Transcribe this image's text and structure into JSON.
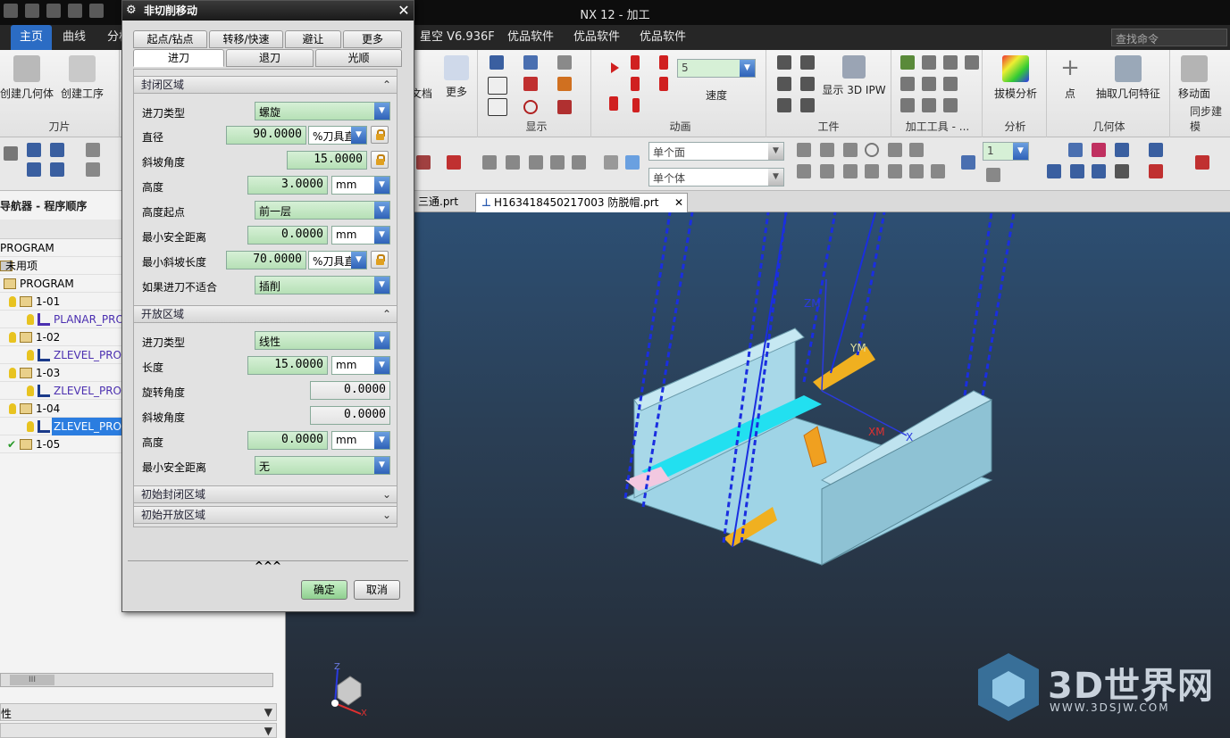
{
  "app": {
    "title": "NX 12 - 加工",
    "search_placeholder": "查找命令"
  },
  "menu": {
    "tabs": [
      "主页",
      "曲线",
      "分析",
      "星空 V6.936F",
      "优品软件",
      "优品软件",
      "优品软件"
    ]
  },
  "ribbon": {
    "left_buttons": [
      "创建几何体",
      "创建工序"
    ],
    "left_group": "刀片",
    "more_btns": [
      "文档",
      "更多"
    ],
    "display_group": "显示",
    "anim_group": "动画",
    "speed_value": "5",
    "speed_label": "速度",
    "show_ipw": "显示 3D IPW",
    "workpiece_group": "工件",
    "machining_tools_group": "加工工具 - ...",
    "draft_analysis": "拔模分析",
    "analysis_group": "分析",
    "point": "点",
    "extract_geom": "抽取几何特征",
    "geometry_group": "几何体",
    "move_face": "移动面",
    "sync_modeling": "同步建模"
  },
  "toolbar2": {
    "filter_face": "单个面",
    "filter_body": "单个体",
    "layer_value": "1"
  },
  "navigator": {
    "title": "导航器 - 程序顺序",
    "rows": [
      {
        "text": "PROGRAM",
        "type": "root"
      },
      {
        "text": "未用项",
        "type": "folder"
      },
      {
        "text": "PROGRAM",
        "type": "folder"
      },
      {
        "text": "1-01",
        "type": "group"
      },
      {
        "text": "PLANAR_PROFILE",
        "type": "op"
      },
      {
        "text": "1-02",
        "type": "group"
      },
      {
        "text": "ZLEVEL_PROFILE",
        "type": "op"
      },
      {
        "text": "1-03",
        "type": "group"
      },
      {
        "text": "ZLEVEL_PROFILE",
        "type": "op"
      },
      {
        "text": "1-04",
        "type": "group"
      },
      {
        "text": "ZLEVEL_PROFILE",
        "type": "op-selected"
      },
      {
        "text": "1-05",
        "type": "group-check"
      }
    ],
    "bottom_label": "性"
  },
  "doc_tabs": {
    "tab1": "三通.prt",
    "tab2": "H163418450217003 防脱帽.prt"
  },
  "dialog": {
    "title": "非切削移动",
    "tabs_row1": [
      "起点/钻点",
      "转移/快速",
      "避让",
      "更多"
    ],
    "tabs_row2": [
      "进刀",
      "退刀",
      "光顺"
    ],
    "closed": {
      "header": "封闭区域",
      "engage_type_label": "进刀类型",
      "engage_type": "螺旋",
      "diameter_label": "直径",
      "diameter": "90.0000",
      "diameter_unit": "%刀具直",
      "ramp_angle_label": "斜坡角度",
      "ramp_angle": "15.0000",
      "height_label": "高度",
      "height": "3.0000",
      "height_unit": "mm",
      "height_from_label": "高度起点",
      "height_from": "前一层",
      "min_clear_label": "最小安全距离",
      "min_clear": "0.0000",
      "min_clear_unit": "mm",
      "min_ramp_label": "最小斜坡长度",
      "min_ramp": "70.0000",
      "min_ramp_unit": "%刀具直",
      "unfit_label": "如果进刀不适合",
      "unfit": "插削"
    },
    "open": {
      "header": "开放区域",
      "engage_type_label": "进刀类型",
      "engage_type": "线性",
      "length_label": "长度",
      "length": "15.0000",
      "length_unit": "mm",
      "rotate_label": "旋转角度",
      "rotate": "0.0000",
      "ramp_label": "斜坡角度",
      "ramp": "0.0000",
      "height_label": "高度",
      "height": "0.0000",
      "height_unit": "mm",
      "min_clear_label": "最小安全距离",
      "min_clear": "无"
    },
    "init_closed": "初始封闭区域",
    "init_open": "初始开放区域",
    "expand_glyph": "^^^",
    "ok": "确定",
    "cancel": "取消"
  },
  "viewport": {
    "axis_zm": "ZM",
    "axis_xm": "XM",
    "axis_x": "X",
    "axis_ym": "YM",
    "triad_z": "Z",
    "triad_x": "X"
  },
  "watermark": {
    "brand": "3D世界网",
    "url": "WWW.3DSJW.COM"
  }
}
